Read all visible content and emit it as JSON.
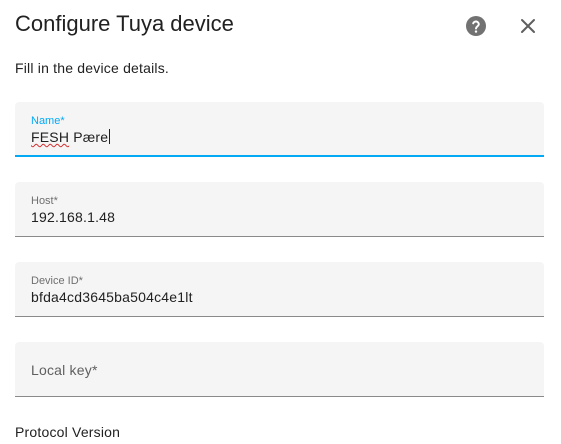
{
  "dialog": {
    "title": "Configure Tuya device",
    "description": "Fill in the device details.",
    "help_icon": "help-circle-icon",
    "close_icon": "close-icon"
  },
  "fields": {
    "name": {
      "label": "Name*",
      "value_misspelled": "FESH",
      "value_rest": " Pære",
      "focused": true
    },
    "host": {
      "label": "Host*",
      "value": "192.168.1.48"
    },
    "device_id": {
      "label": "Device ID*",
      "value": "bfda4cd3645ba504c4e1lt"
    },
    "local_key": {
      "label": "Local key*",
      "value": ""
    }
  },
  "protocol_version": {
    "label": "Protocol Version"
  },
  "colors": {
    "accent": "#03a9f4",
    "field_bg": "#f5f5f5",
    "text": "#212121"
  }
}
